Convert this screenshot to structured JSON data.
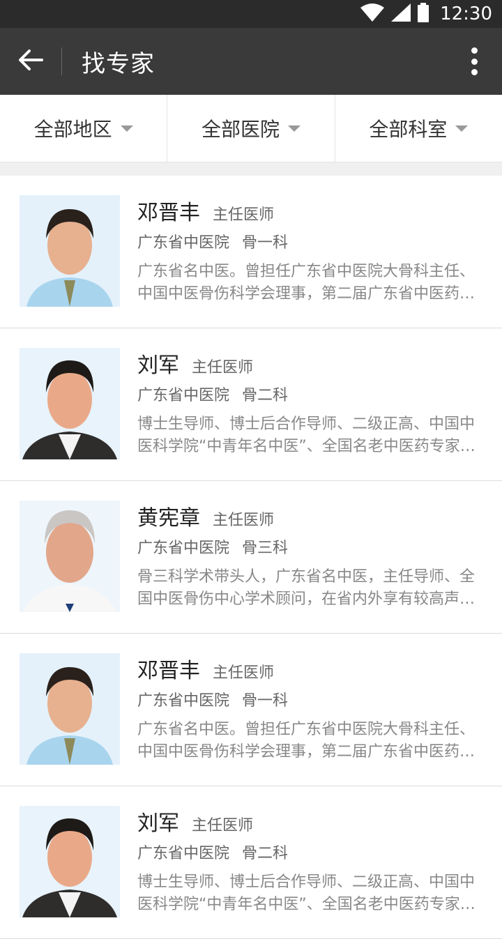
{
  "status": {
    "time": "12:30"
  },
  "header": {
    "title": "找专家"
  },
  "filters": [
    {
      "label": "全部地区"
    },
    {
      "label": "全部医院"
    },
    {
      "label": "全部科室"
    }
  ],
  "doctors": [
    {
      "name": "邓晋丰",
      "title": "主任医师",
      "hospital": "广东省中医院",
      "dept": "骨一科",
      "desc": "广东省名中医。曾担任广东省中医院大骨科主任、中国中医骨伤科学会理事，第二届广东省中医药学会骨伤科专业委员会主任委员…"
    },
    {
      "name": "刘军",
      "title": "主任医师",
      "hospital": "广东省中医院",
      "dept": "骨二科",
      "desc": "博士生导师、博士后合作导师、二级正高、中国中医科学院“中青年名中医”、全国名老中医药专家学术经验继承人…"
    },
    {
      "name": "黄宪章",
      "title": "主任医师",
      "hospital": "广东省中医院",
      "dept": "骨三科",
      "desc": "骨三科学术带头人，广东省名中医，主任导师、全国中医骨伤中心学术顾问，在省内外享有较高声誉…"
    },
    {
      "name": "邓晋丰",
      "title": "主任医师",
      "hospital": "广东省中医院",
      "dept": "骨一科",
      "desc": "广东省名中医。曾担任广东省中医院大骨科主任、中国中医骨伤科学会理事，第二届广东省中医药学会骨伤科专业委员会主任委员…"
    },
    {
      "name": "刘军",
      "title": "主任医师",
      "hospital": "广东省中医院",
      "dept": "骨二科",
      "desc": "博士生导师、博士后合作导师、二级正高、中国中医科学院“中青年名中医”、全国名老中医药专家学术经验继承人…"
    }
  ]
}
